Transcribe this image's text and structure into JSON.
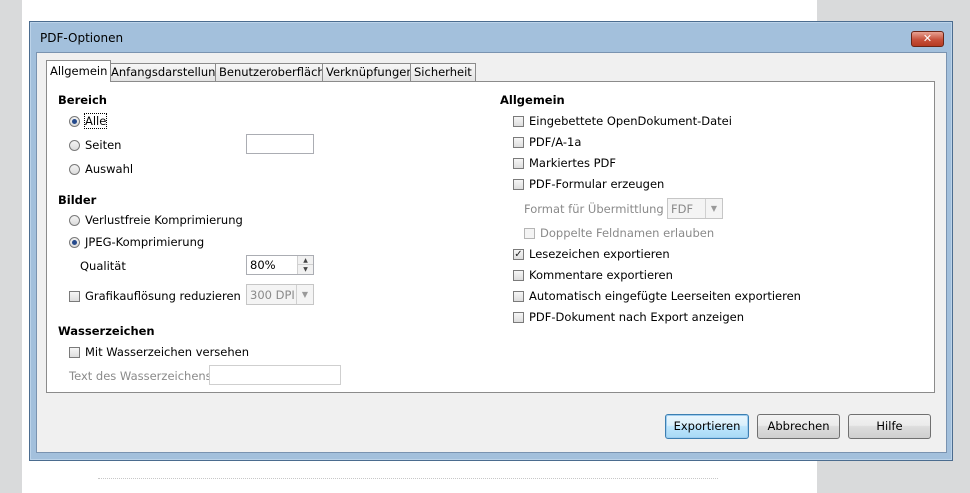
{
  "dialog": {
    "title": "PDF-Optionen",
    "close_symbol": "✕"
  },
  "tabs": [
    {
      "label": "Allgemein"
    },
    {
      "label": "Anfangsdarstellung"
    },
    {
      "label": "Benutzeroberfläche"
    },
    {
      "label": "Verknüpfungen"
    },
    {
      "label": "Sicherheit"
    }
  ],
  "bereich": {
    "heading": "Bereich",
    "alle": "Alle",
    "seiten": "Seiten",
    "auswahl": "Auswahl",
    "seiten_value": ""
  },
  "bilder": {
    "heading": "Bilder",
    "verlustfrei": "Verlustfreie Komprimierung",
    "jpeg": "JPEG-Komprimierung",
    "qualitaet_label": "Qualität",
    "qualitaet_value": "80%",
    "grafik_label": "Grafikauflösung reduzieren",
    "dpi_value": "300 DPI"
  },
  "wasserzeichen": {
    "heading": "Wasserzeichen",
    "mit_label": "Mit Wasserzeichen versehen",
    "text_label": "Text des Wasserzeichens",
    "text_value": ""
  },
  "allgemein": {
    "heading": "Allgemein",
    "odf": "Eingebettete OpenDokument-Datei",
    "pdfa": "PDF/A-1a",
    "markiert": "Markiertes PDF",
    "formular": "PDF-Formular erzeugen",
    "format_label": "Format für Übermittlung",
    "format_value": "FDF",
    "doppelte": "Doppelte Feldnamen erlauben",
    "lesezeichen": "Lesezeichen exportieren",
    "kommentare": "Kommentare exportieren",
    "leerseiten": "Automatisch eingefügte Leerseiten exportieren",
    "anzeigen": "PDF-Dokument nach Export anzeigen",
    "check_mark": "✓"
  },
  "buttons": {
    "export": "Exportieren",
    "cancel": "Abbrechen",
    "help": "Hilfe"
  },
  "spin": {
    "up": "▲",
    "down": "▼"
  },
  "combo_arrow": "▼"
}
